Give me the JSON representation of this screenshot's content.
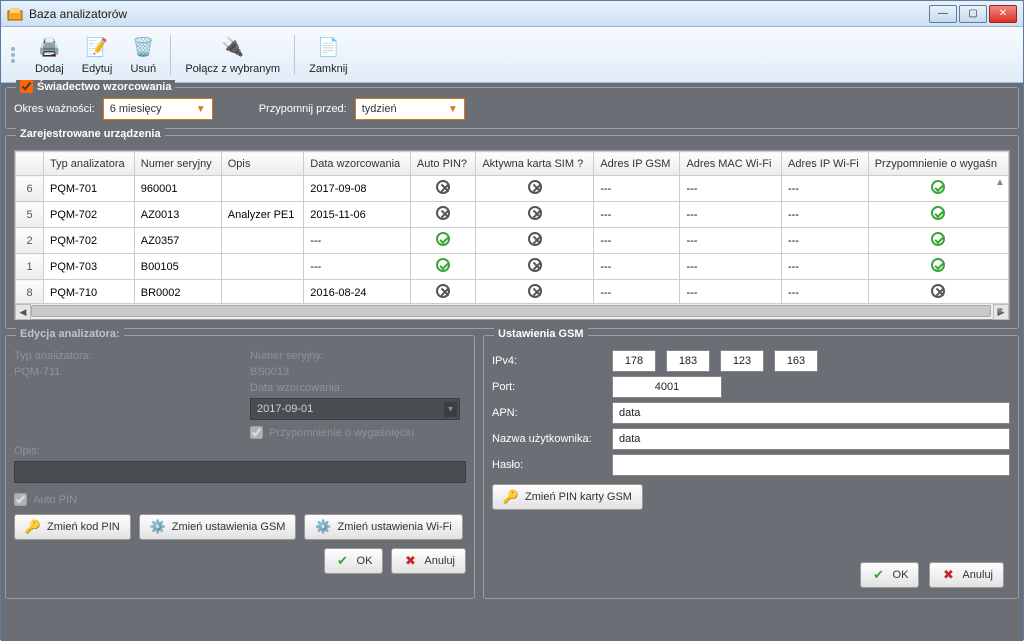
{
  "window": {
    "title": "Baza analizatorów"
  },
  "toolbar": {
    "add": "Dodaj",
    "edit": "Edytuj",
    "delete": "Usuń",
    "connect": "Połącz z wybranym",
    "close": "Zamknij"
  },
  "calibration": {
    "title": "Świadectwo wzorcowania",
    "validity_label": "Okres ważności:",
    "validity_value": "6 miesięcy",
    "remind_label": "Przypomnij przed:",
    "remind_value": "tydzień"
  },
  "registered": {
    "title": "Zarejestrowane urządzenia",
    "headers": {
      "type": "Typ analizatora",
      "serial": "Numer seryjny",
      "desc": "Opis",
      "caldate": "Data wzorcowania",
      "autopin": "Auto PIN?",
      "sim": "Aktywna karta SIM ?",
      "ipgsm": "Adres IP GSM",
      "macwifi": "Adres MAC Wi-Fi",
      "ipwifi": "Adres IP Wi-Fi",
      "reminder": "Przypomnienie o wygaśn"
    },
    "rows": [
      {
        "n": "6",
        "type": "PQM-701",
        "serial": "960001",
        "desc": "",
        "caldate": "2017-09-08",
        "autopin": false,
        "sim": false,
        "ipgsm": "---",
        "macwifi": "---",
        "ipwifi": "---",
        "reminder": true
      },
      {
        "n": "5",
        "type": "PQM-702",
        "serial": "AZ0013",
        "desc": "Analyzer PE1",
        "caldate": "2015-11-06",
        "autopin": false,
        "sim": false,
        "ipgsm": "---",
        "macwifi": "---",
        "ipwifi": "---",
        "reminder": true
      },
      {
        "n": "2",
        "type": "PQM-702",
        "serial": "AZ0357",
        "desc": "",
        "caldate": "---",
        "autopin": true,
        "sim": false,
        "ipgsm": "---",
        "macwifi": "---",
        "ipwifi": "---",
        "reminder": true
      },
      {
        "n": "1",
        "type": "PQM-703",
        "serial": "B00105",
        "desc": "",
        "caldate": "---",
        "autopin": true,
        "sim": false,
        "ipgsm": "---",
        "macwifi": "---",
        "ipwifi": "---",
        "reminder": true
      },
      {
        "n": "8",
        "type": "PQM-710",
        "serial": "BR0002",
        "desc": "",
        "caldate": "2016-08-24",
        "autopin": false,
        "sim": false,
        "ipgsm": "---",
        "macwifi": "---",
        "ipwifi": "---",
        "reminder": false
      }
    ]
  },
  "editor": {
    "title": "Edycja analizatora:",
    "type_label": "Typ analizatora:",
    "type_value": "PQM-711",
    "serial_label": "Numer seryjny:",
    "serial_value": "BS0013",
    "caldate_label": "Data wzorcowania:",
    "caldate_value": "2017-09-01",
    "reminder_label": "Przypomnienie o wygaśnięciu",
    "desc_label": "Opis:",
    "autopin_label": "Auto PIN",
    "change_pin": "Zmień kod PIN",
    "change_gsm": "Zmień ustawienia GSM",
    "change_wifi": "Zmień ustawienia Wi-Fi",
    "ok": "OK",
    "cancel": "Anuluj"
  },
  "gsm": {
    "title": "Ustawienia GSM",
    "ipv4_label": "IPv4:",
    "ip": [
      "178",
      "183",
      "123",
      "163"
    ],
    "port_label": "Port:",
    "port_value": "4001",
    "apn_label": "APN:",
    "apn_value": "data",
    "user_label": "Nazwa użytkownika:",
    "user_value": "data",
    "pass_label": "Hasło:",
    "pass_value": "",
    "change_sim_pin": "Zmień PIN karty GSM",
    "ok": "OK",
    "cancel": "Anuluj"
  }
}
